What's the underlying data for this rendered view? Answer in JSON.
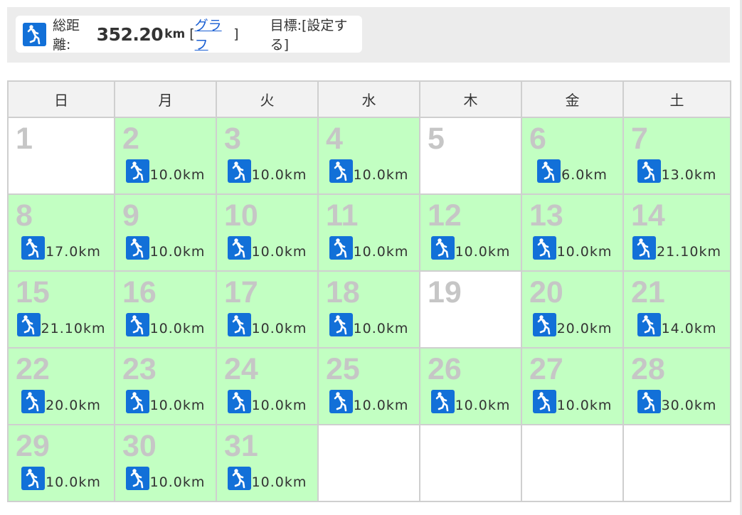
{
  "header": {
    "total_label": "総距離:",
    "total_value": "352.20",
    "total_unit": "km",
    "graph_open": "[",
    "graph_link": "グラフ",
    "graph_close": "]",
    "goal_label": "目標:[設定する]",
    "icon": "runner-icon"
  },
  "calendar": {
    "weekdays": [
      "日",
      "月",
      "火",
      "水",
      "木",
      "金",
      "土"
    ],
    "weeks": [
      [
        {
          "day": "1",
          "dist": ""
        },
        {
          "day": "2",
          "dist": "10.0km"
        },
        {
          "day": "3",
          "dist": "10.0km"
        },
        {
          "day": "4",
          "dist": "10.0km"
        },
        {
          "day": "5",
          "dist": ""
        },
        {
          "day": "6",
          "dist": "6.0km"
        },
        {
          "day": "7",
          "dist": "13.0km"
        }
      ],
      [
        {
          "day": "8",
          "dist": "17.0km"
        },
        {
          "day": "9",
          "dist": "10.0km"
        },
        {
          "day": "10",
          "dist": "10.0km"
        },
        {
          "day": "11",
          "dist": "10.0km"
        },
        {
          "day": "12",
          "dist": "10.0km"
        },
        {
          "day": "13",
          "dist": "10.0km"
        },
        {
          "day": "14",
          "dist": "21.10km"
        }
      ],
      [
        {
          "day": "15",
          "dist": "21.10km"
        },
        {
          "day": "16",
          "dist": "10.0km"
        },
        {
          "day": "17",
          "dist": "10.0km"
        },
        {
          "day": "18",
          "dist": "10.0km"
        },
        {
          "day": "19",
          "dist": ""
        },
        {
          "day": "20",
          "dist": "20.0km"
        },
        {
          "day": "21",
          "dist": "14.0km"
        }
      ],
      [
        {
          "day": "22",
          "dist": "20.0km"
        },
        {
          "day": "23",
          "dist": "10.0km"
        },
        {
          "day": "24",
          "dist": "10.0km"
        },
        {
          "day": "25",
          "dist": "10.0km"
        },
        {
          "day": "26",
          "dist": "10.0km"
        },
        {
          "day": "27",
          "dist": "10.0km"
        },
        {
          "day": "28",
          "dist": "30.0km"
        }
      ],
      [
        {
          "day": "29",
          "dist": "10.0km"
        },
        {
          "day": "30",
          "dist": "10.0km"
        },
        {
          "day": "31",
          "dist": "10.0km"
        },
        {
          "day": "",
          "dist": ""
        },
        {
          "day": "",
          "dist": ""
        },
        {
          "day": "",
          "dist": ""
        },
        {
          "day": "",
          "dist": ""
        }
      ]
    ]
  },
  "colors": {
    "run_day_bg": "#c2ffc2",
    "icon_bg": "#1270d8",
    "day_number": "#c6c6c6",
    "link": "#1a5fd3"
  }
}
